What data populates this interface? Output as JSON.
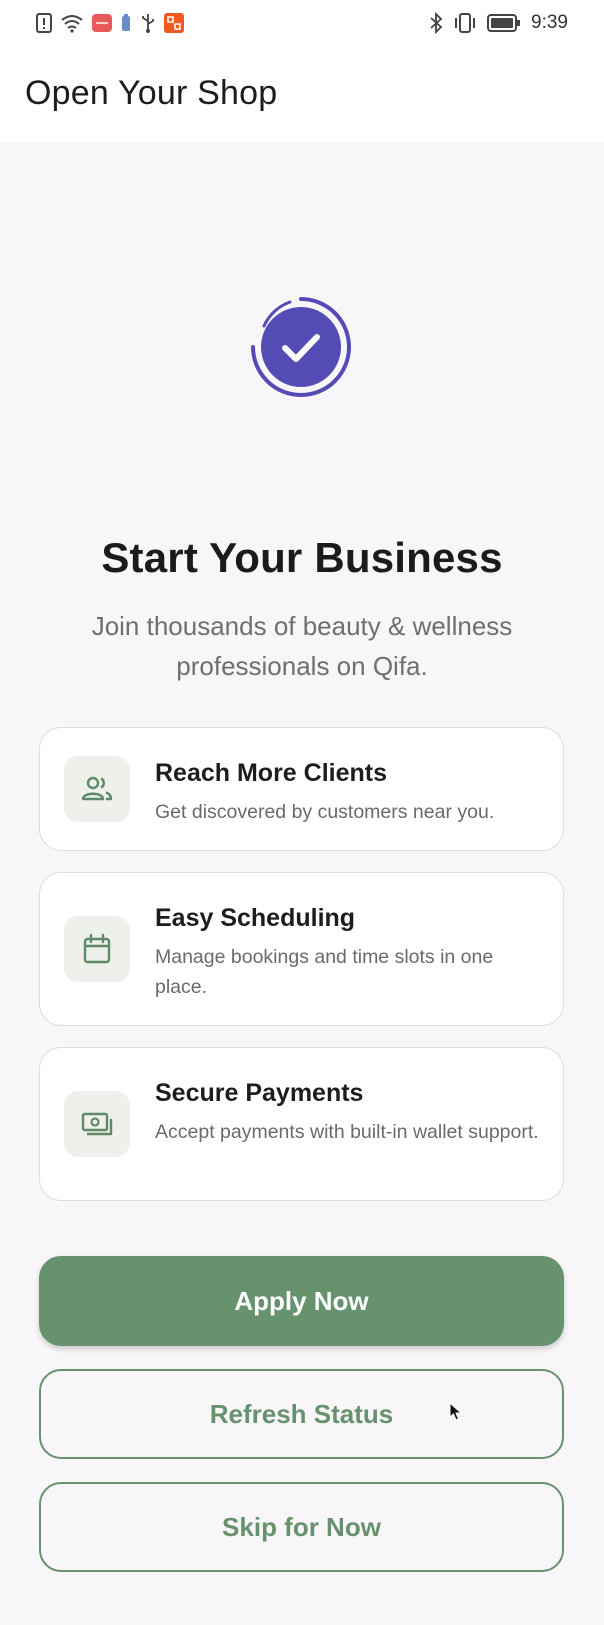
{
  "status_bar": {
    "time": "9:39",
    "left_icons": [
      "alert-icon",
      "wifi-icon",
      "app-notification-icon",
      "battery-saver-icon",
      "usb-icon",
      "app-icon"
    ],
    "right_icons": [
      "bluetooth-icon",
      "vibrate-icon",
      "battery-icon"
    ]
  },
  "app_bar": {
    "title": "Open Your Shop"
  },
  "hero": {
    "icon": "check-circle-icon",
    "title": "Start Your Business",
    "subtitle": "Join thousands of beauty & wellness professionals on Qifa."
  },
  "features": [
    {
      "icon": "people-icon",
      "title": "Reach More Clients",
      "description": "Get discovered by customers near you."
    },
    {
      "icon": "calendar-icon",
      "title": "Easy Scheduling",
      "description": "Manage bookings and time slots in one place."
    },
    {
      "icon": "payments-icon",
      "title": "Secure Payments",
      "description": "Accept payments with built-in wallet support."
    }
  ],
  "actions": {
    "apply_label": "Apply Now",
    "refresh_label": "Refresh Status",
    "skip_label": "Skip for Now"
  },
  "colors": {
    "accent_green": "#66926e",
    "hero_purple": "#544bb5",
    "background": "#f9f6fa"
  }
}
